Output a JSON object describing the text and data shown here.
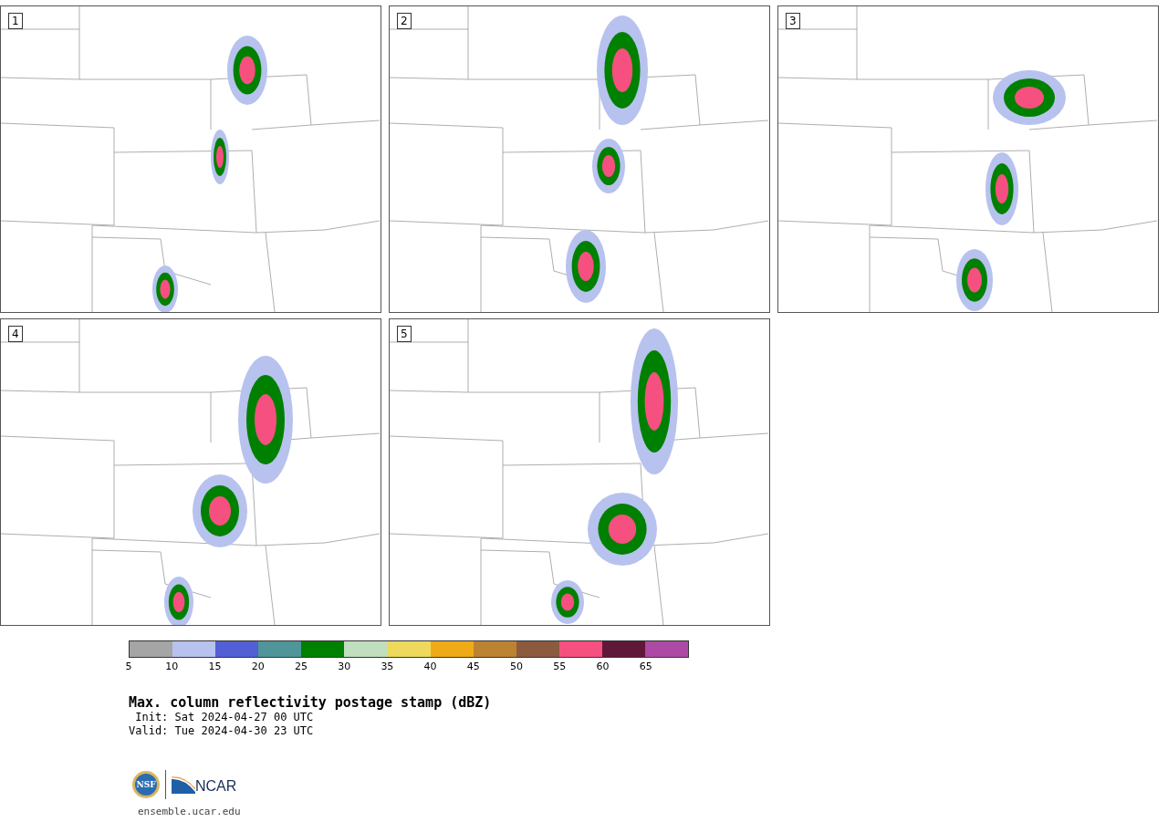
{
  "panels": [
    {
      "label": "1"
    },
    {
      "label": "2"
    },
    {
      "label": "3"
    },
    {
      "label": "4"
    },
    {
      "label": "5"
    }
  ],
  "colorbar": {
    "segments": [
      {
        "color": "#a5a5a5"
      },
      {
        "color": "#b7c2ee"
      },
      {
        "color": "#525fd5"
      },
      {
        "color": "#4f959a"
      },
      {
        "color": "#008000"
      },
      {
        "color": "#bfdfbf"
      },
      {
        "color": "#eed95d"
      },
      {
        "color": "#efab17"
      },
      {
        "color": "#bb8331"
      },
      {
        "color": "#8b5a3f"
      },
      {
        "color": "#f5507f"
      },
      {
        "color": "#601838"
      },
      {
        "color": "#ac4aa5"
      }
    ],
    "ticks": [
      "5",
      "10",
      "15",
      "20",
      "25",
      "30",
      "35",
      "40",
      "45",
      "50",
      "55",
      "60",
      "65"
    ]
  },
  "title": "Max. column reflectivity postage stamp (dBZ)",
  "init": " Init: Sat 2024-04-27 00 UTC",
  "valid": "Valid: Tue 2024-04-30 23 UTC",
  "logo": {
    "seal_text": "NSF",
    "wordmark": "NCAR"
  },
  "website": "ensemble.ucar.edu"
}
